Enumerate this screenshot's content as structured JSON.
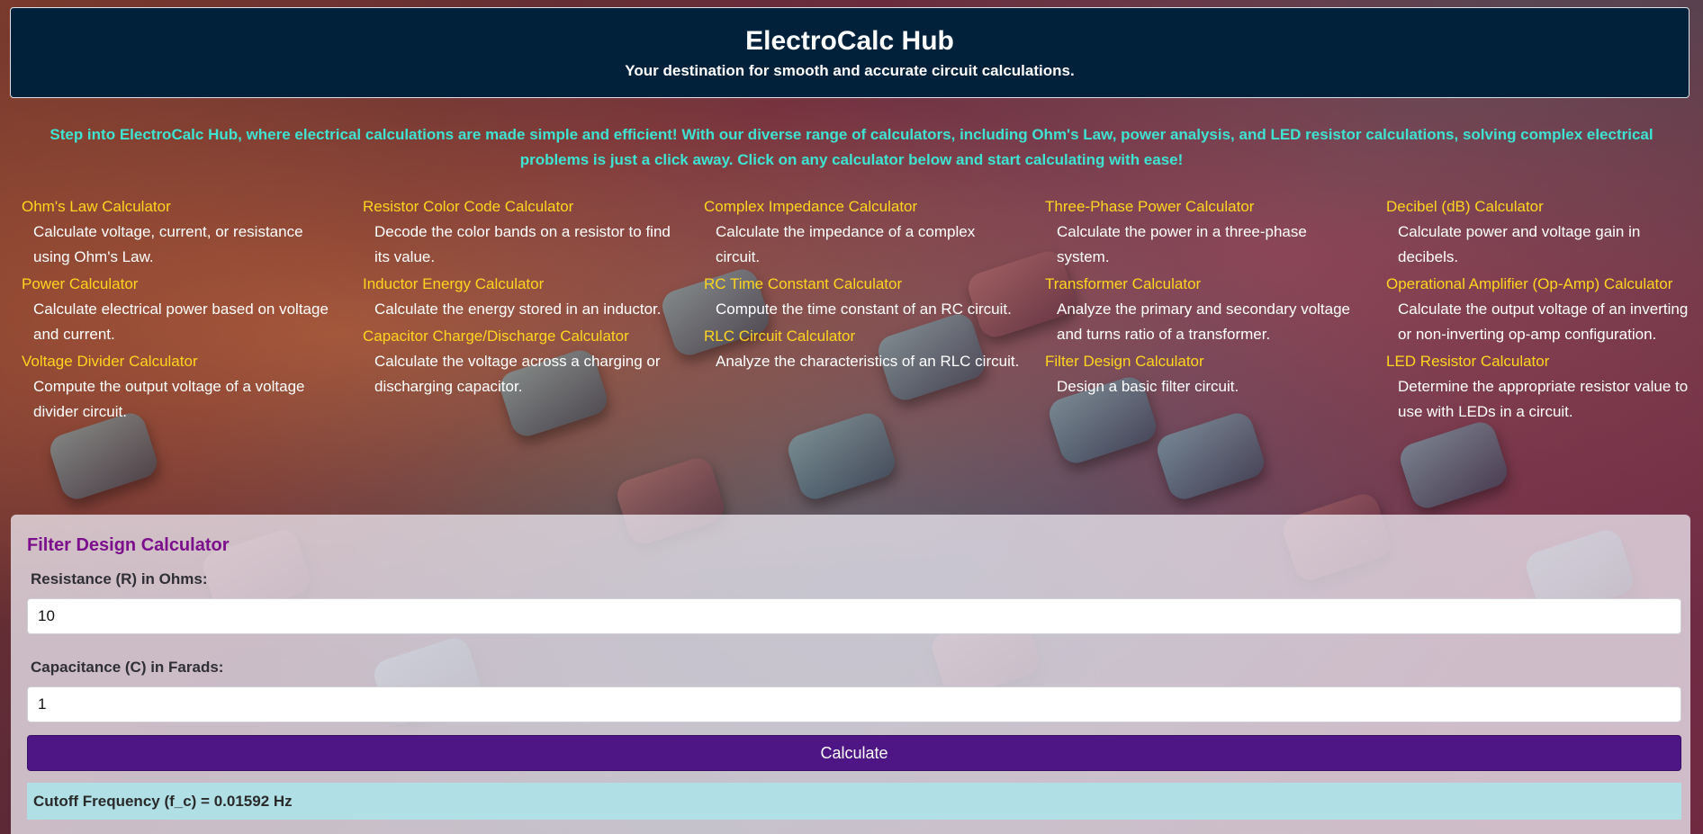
{
  "header": {
    "title": "ElectroCalc Hub",
    "subtitle": "Your destination for smooth and accurate circuit calculations."
  },
  "intro": "Step into ElectroCalc Hub, where electrical calculations are made simple and efficient! With our diverse range of calculators, including Ohm's Law, power analysis, and LED resistor calculations, solving complex electrical problems is just a click away. Click on any calculator below and start calculating with ease!",
  "calculators": {
    "col1": [
      {
        "title": "Ohm's Law Calculator",
        "desc": "Calculate voltage, current, or resistance using Ohm's Law."
      },
      {
        "title": "Power Calculator",
        "desc": "Calculate electrical power based on voltage and current."
      },
      {
        "title": "Voltage Divider Calculator",
        "desc": "Compute the output voltage of a voltage divider circuit."
      }
    ],
    "col2": [
      {
        "title": "Resistor Color Code Calculator",
        "desc": "Decode the color bands on a resistor to find its value."
      },
      {
        "title": "Inductor Energy Calculator",
        "desc": "Calculate the energy stored in an inductor."
      },
      {
        "title": "Capacitor Charge/Discharge Calculator",
        "desc": "Calculate the voltage across a charging or discharging capacitor."
      }
    ],
    "col3": [
      {
        "title": "Complex Impedance Calculator",
        "desc": "Calculate the impedance of a complex circuit."
      },
      {
        "title": "RC Time Constant Calculator",
        "desc": "Compute the time constant of an RC circuit."
      },
      {
        "title": "RLC Circuit Calculator",
        "desc": "Analyze the characteristics of an RLC circuit."
      }
    ],
    "col4": [
      {
        "title": "Three-Phase Power Calculator",
        "desc": "Calculate the power in a three-phase system."
      },
      {
        "title": "Transformer Calculator",
        "desc": "Analyze the primary and secondary voltage and turns ratio of a transformer."
      },
      {
        "title": "Filter Design Calculator",
        "desc": "Design a basic filter circuit."
      }
    ],
    "col5": [
      {
        "title": "Decibel (dB) Calculator",
        "desc": "Calculate power and voltage gain in decibels."
      },
      {
        "title": "Operational Amplifier (Op-Amp) Calculator",
        "desc": "Calculate the output voltage of an inverting or non-inverting op-amp configuration."
      },
      {
        "title": "LED Resistor Calculator",
        "desc": "Determine the appropriate resistor value to use with LEDs in a circuit."
      }
    ]
  },
  "panel": {
    "title": "Filter Design Calculator",
    "resistance_label": "Resistance (R) in Ohms:",
    "resistance_value": "10",
    "capacitance_label": "Capacitance (C) in Farads:",
    "capacitance_value": "1",
    "button_label": "Calculate",
    "result": "Cutoff Frequency (f_c) = 0.01592 Hz"
  },
  "colors": {
    "header_bg": "#012039",
    "intro_text": "#3ee3d1",
    "calc_title": "#ffd51f",
    "panel_title": "#7b0f8c",
    "button_bg": "#4e1585",
    "result_bg": "#b0e0e6"
  }
}
